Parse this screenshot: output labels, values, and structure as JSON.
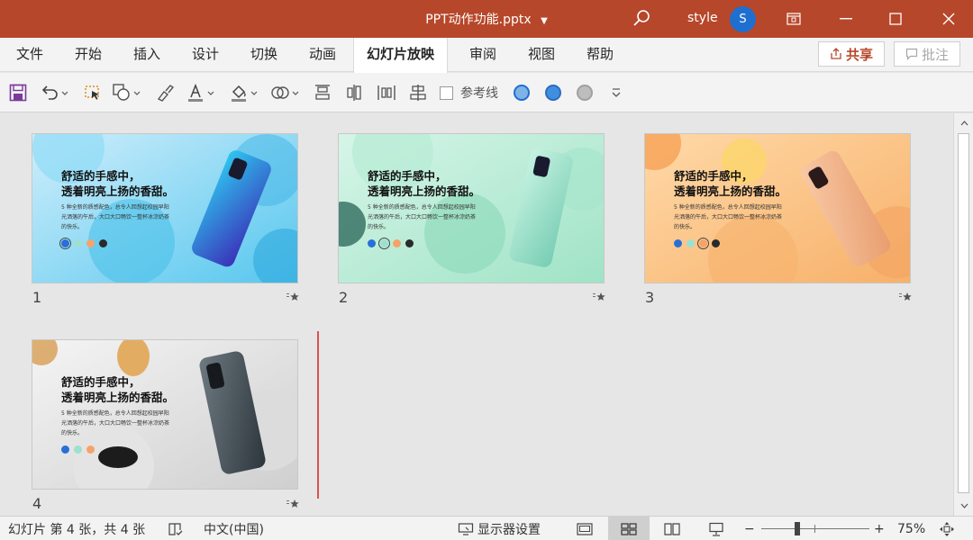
{
  "titlebar": {
    "doc_title": "PPT动作功能.pptx",
    "user": "style",
    "avatar_initial": "S"
  },
  "tabs": [
    {
      "label": "文件"
    },
    {
      "label": "开始"
    },
    {
      "label": "插入"
    },
    {
      "label": "设计"
    },
    {
      "label": "切换"
    },
    {
      "label": "动画"
    },
    {
      "label": "幻灯片放映",
      "active": true
    },
    {
      "label": "审阅"
    },
    {
      "label": "视图"
    },
    {
      "label": "帮助"
    }
  ],
  "share_label": "共享",
  "comment_label": "批注",
  "qat": {
    "reference_line_label": "参考线"
  },
  "slides": [
    {
      "number": "1",
      "title_line1": "舒适的手感中，",
      "title_line2": "透着明亮上扬的香甜。",
      "body": "5 种全新的质感配色，总令人回想起校园早阳光洒落的午后，大口大口畅饮一整杯冰淙奶茶的快乐。"
    },
    {
      "number": "2",
      "title_line1": "舒适的手感中，",
      "title_line2": "透着明亮上扬的香甜。",
      "body": "5 种全新的质感配色，总令人回想起校园早阳光洒落的午后，大口大口畅饮一整杯冰淙奶茶的快乐。"
    },
    {
      "number": "3",
      "title_line1": "舒适的手感中，",
      "title_line2": "透着明亮上扬的香甜。",
      "body": "5 种全新的质感配色，总令人回想起校园早阳光洒落的午后，大口大口畅饮一整杯冰淙奶茶的快乐。"
    },
    {
      "number": "4",
      "title_line1": "舒适的手感中，",
      "title_line2": "透着明亮上扬的香甜。",
      "body": "5 种全新的质感配色，总令人回想起校园早阳光洒落的午后，大口大口畅饮一整杯冰淙奶茶的快乐。"
    }
  ],
  "status": {
    "slide_info": "幻灯片 第 4 张，共 4 张",
    "language": "中文(中国)",
    "display_settings": "显示器设置",
    "zoom_minus": "−",
    "zoom_plus": "+",
    "zoom_level": "75%"
  },
  "colors": {
    "brand": "#b7472a",
    "avatar": "#1f6fd0",
    "accent_purple": "#7a3b9a",
    "insert_marker": "#d9534f"
  }
}
